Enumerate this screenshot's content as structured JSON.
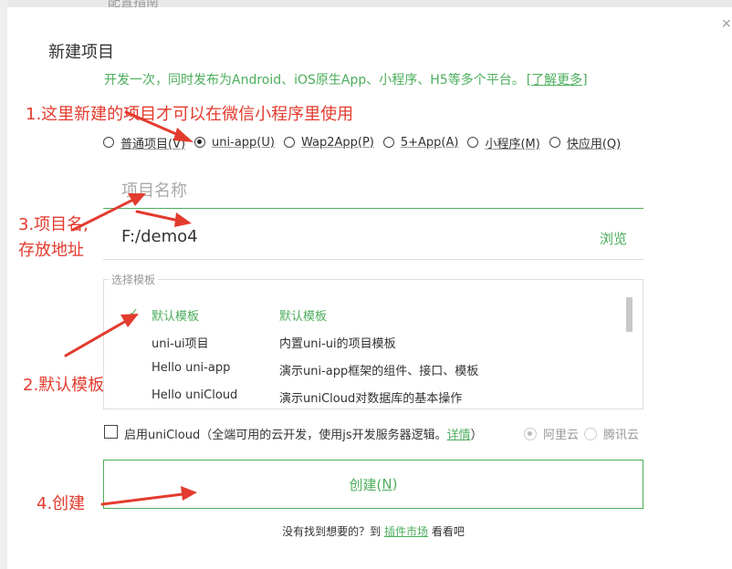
{
  "background": {
    "top_text": "配置指南"
  },
  "dialog": {
    "title": "新建项目",
    "subtitle": "开发一次，同时发布为Android、iOS原生App、小程序、H5等多个平台。",
    "subtitle_link": "[了解更多]",
    "close_glyph": "×"
  },
  "project_types": [
    {
      "label": "普通项目(V)",
      "checked": false
    },
    {
      "label": "uni-app(U)",
      "checked": true
    },
    {
      "label": "Wap2App(P)",
      "checked": false
    },
    {
      "label": "5+App(A)",
      "checked": false
    },
    {
      "label": "小程序(M)",
      "checked": false
    },
    {
      "label": "快应用(Q)",
      "checked": false
    }
  ],
  "name_field": {
    "placeholder": "项目名称",
    "value": ""
  },
  "path_field": {
    "value": "F:/demo4",
    "browse_label": "浏览"
  },
  "templates": {
    "legend": "选择模板",
    "check_glyph": "✓",
    "items": [
      {
        "name": "默认模板",
        "desc": "默认模板",
        "selected": true
      },
      {
        "name": "uni-ui项目",
        "desc": "内置uni-ui的项目模板",
        "selected": false
      },
      {
        "name": "Hello uni-app",
        "desc": "演示uni-app框架的组件、接口、模板",
        "selected": false
      },
      {
        "name": "Hello uniCloud",
        "desc": "演示uniCloud对数据库的基本操作",
        "selected": false
      }
    ]
  },
  "unicloud": {
    "label": "启用uniCloud（全端可用的云开发，使用js开发服务器逻辑。",
    "link": "详情",
    "label_end": "）",
    "providers": [
      "阿里云",
      "腾讯云"
    ]
  },
  "create_button": {
    "label": "创建(",
    "key": "N",
    "label_end": ")"
  },
  "footer": {
    "prefix": "没有找到想要的？到 ",
    "link": "插件市场",
    "suffix": " 看看吧"
  },
  "annotations": {
    "a1": "1.这里新建的项目才可以在微信小程序里使用",
    "a3_line1": "3.项目名,",
    "a3_line2": "存放地址",
    "a2": "2.默认模板",
    "a4": "4.创建",
    "color": "#e33b2e"
  },
  "colors": {
    "accent": "#4cae5c",
    "annotation": "#e33b2e"
  }
}
